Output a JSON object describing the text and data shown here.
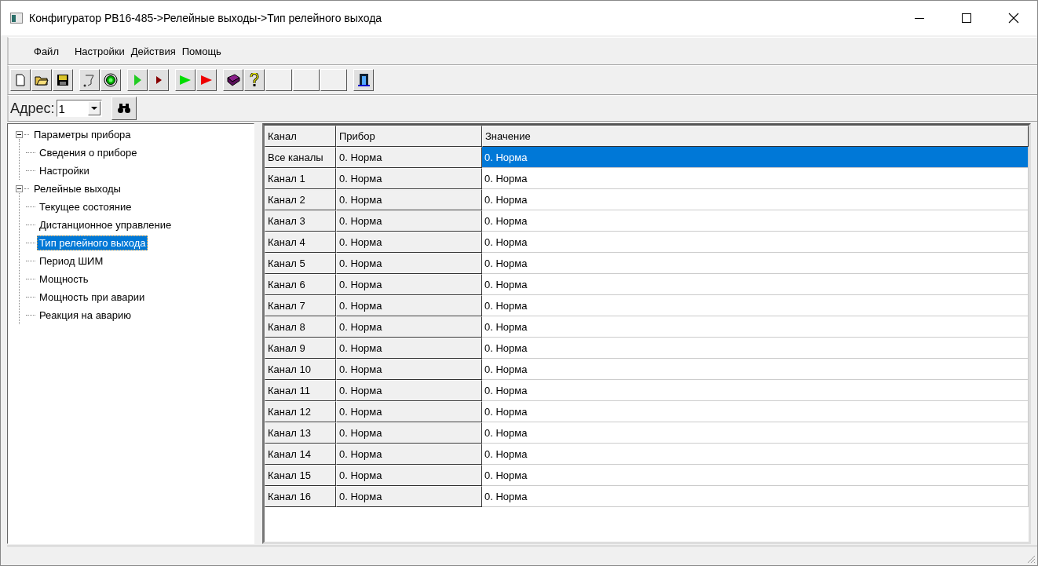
{
  "window": {
    "title": "Конфигуратор РВ16-485->Релейные выходы->Тип релейного выхода"
  },
  "menu": [
    "Файл",
    "Настройки",
    "Действия",
    "Помощь"
  ],
  "address": {
    "label": "Адрес:",
    "value": "1"
  },
  "tree": [
    {
      "label": "Параметры прибора",
      "expanded": true,
      "selected": false,
      "children": [
        {
          "label": "Сведения о приборе",
          "selected": false
        },
        {
          "label": "Настройки",
          "selected": false
        }
      ]
    },
    {
      "label": "Релейные выходы",
      "expanded": true,
      "selected": false,
      "children": [
        {
          "label": "Текущее состояние",
          "selected": false
        },
        {
          "label": "Дистанционное управление",
          "selected": false
        },
        {
          "label": "Тип релейного выхода",
          "selected": true
        },
        {
          "label": "Период ШИМ",
          "selected": false
        },
        {
          "label": "Мощность",
          "selected": false
        },
        {
          "label": "Мощность при аварии",
          "selected": false
        },
        {
          "label": "Реакция на аварию",
          "selected": false
        }
      ]
    }
  ],
  "table": {
    "columns": [
      "Канал",
      "Прибор",
      "Значение"
    ],
    "rows": [
      {
        "channel": "Все каналы",
        "device": "0. Норма",
        "value": "0. Норма",
        "selected": true
      },
      {
        "channel": "Канал 1",
        "device": "0. Норма",
        "value": "0. Норма",
        "selected": false
      },
      {
        "channel": "Канал 2",
        "device": "0. Норма",
        "value": "0. Норма",
        "selected": false
      },
      {
        "channel": "Канал 3",
        "device": "0. Норма",
        "value": "0. Норма",
        "selected": false
      },
      {
        "channel": "Канал 4",
        "device": "0. Норма",
        "value": "0. Норма",
        "selected": false
      },
      {
        "channel": "Канал 5",
        "device": "0. Норма",
        "value": "0. Норма",
        "selected": false
      },
      {
        "channel": "Канал 6",
        "device": "0. Норма",
        "value": "0. Норма",
        "selected": false
      },
      {
        "channel": "Канал 7",
        "device": "0. Норма",
        "value": "0. Норма",
        "selected": false
      },
      {
        "channel": "Канал 8",
        "device": "0. Норма",
        "value": "0. Норма",
        "selected": false
      },
      {
        "channel": "Канал 9",
        "device": "0. Норма",
        "value": "0. Норма",
        "selected": false
      },
      {
        "channel": "Канал 10",
        "device": "0. Норма",
        "value": "0. Норма",
        "selected": false
      },
      {
        "channel": "Канал 11",
        "device": "0. Норма",
        "value": "0. Норма",
        "selected": false
      },
      {
        "channel": "Канал 12",
        "device": "0. Норма",
        "value": "0. Норма",
        "selected": false
      },
      {
        "channel": "Канал 13",
        "device": "0. Норма",
        "value": "0. Норма",
        "selected": false
      },
      {
        "channel": "Канал 14",
        "device": "0. Норма",
        "value": "0. Норма",
        "selected": false
      },
      {
        "channel": "Канал 15",
        "device": "0. Норма",
        "value": "0. Норма",
        "selected": false
      },
      {
        "channel": "Канал 16",
        "device": "0. Норма",
        "value": "0. Норма",
        "selected": false
      }
    ]
  }
}
